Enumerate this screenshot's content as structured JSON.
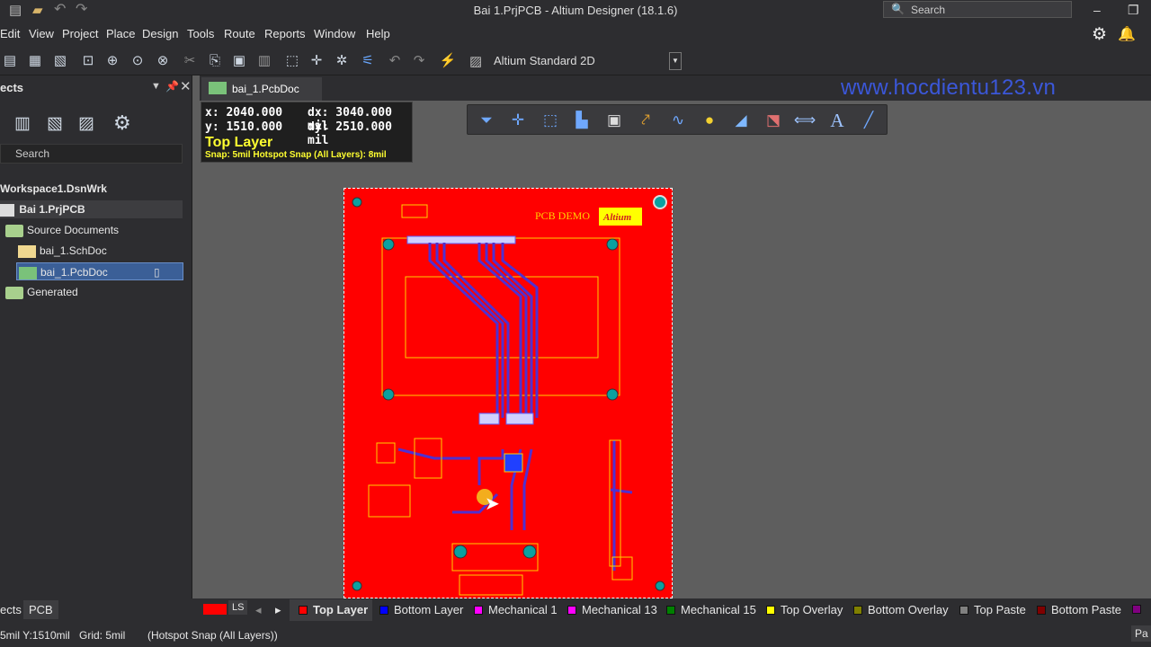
{
  "window": {
    "title": "Bai 1.PrjPCB - Altium Designer (18.1.6)",
    "search_placeholder": "Search"
  },
  "menu": [
    "Edit",
    "View",
    "Project",
    "Place",
    "Design",
    "Tools",
    "Route",
    "Reports",
    "Window",
    "Help"
  ],
  "toolbar": {
    "view_config": "Altium Standard 2D"
  },
  "projects_panel": {
    "title": "ects",
    "search_placeholder": "Search",
    "tree": {
      "workspace": "Workspace1.DsnWrk",
      "project": "Bai 1.PrjPCB",
      "source_documents": "Source Documents",
      "schdoc": "bai_1.SchDoc",
      "pcbdoc": "bai_1.PcbDoc",
      "generated": "Generated"
    }
  },
  "document_tab": "bai_1.PcbDoc",
  "watermark": "www.hocdientu123.vn",
  "hud": {
    "x": "x:  2040.000",
    "dx": "dx:  3040.000 mil",
    "y": "y:  1510.000",
    "dy": "dy:  2510.000 mil",
    "layer": "Top Layer",
    "snap": "Snap: 5mil Hotspot Snap (All Layers): 8mil"
  },
  "board": {
    "silk_title": "PCB DEMO",
    "logo": "Altium"
  },
  "panel_tabs": {
    "left": "ects",
    "pcb": "PCB"
  },
  "layers": {
    "ls": "LS",
    "items": [
      {
        "name": "Top Layer",
        "color": "#ff0000"
      },
      {
        "name": "Bottom Layer",
        "color": "#0000ff"
      },
      {
        "name": "Mechanical 1",
        "color": "#ff00ff"
      },
      {
        "name": "Mechanical 13",
        "color": "#ff00ff"
      },
      {
        "name": "Mechanical 15",
        "color": "#008000"
      },
      {
        "name": "Top Overlay",
        "color": "#ffff00"
      },
      {
        "name": "Bottom Overlay",
        "color": "#808000"
      },
      {
        "name": "Top Paste",
        "color": "#808080"
      },
      {
        "name": "Bottom Paste",
        "color": "#800000"
      }
    ]
  },
  "status": {
    "coords": "5mil Y:1510mil",
    "grid": "Grid: 5mil",
    "snap": "(Hotspot Snap (All Layers))",
    "right": "Pa"
  }
}
